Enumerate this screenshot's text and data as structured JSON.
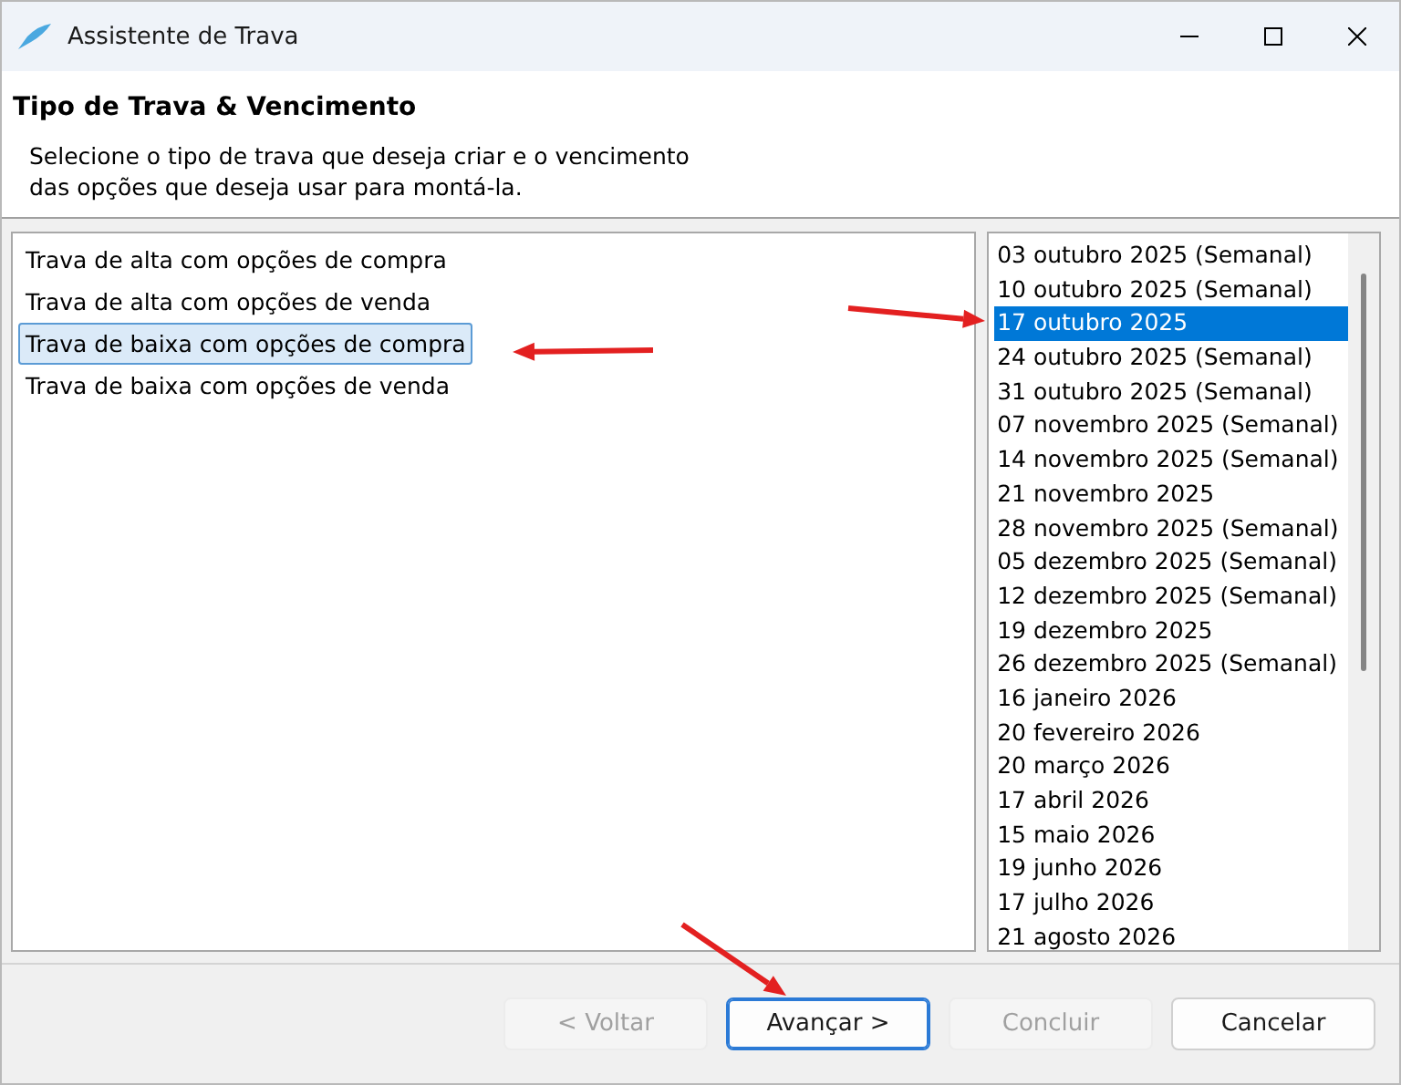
{
  "window": {
    "title": "Assistente de Trava"
  },
  "header": {
    "title": "Tipo de Trava & Vencimento",
    "description": "Selecione o tipo de trava que deseja criar e o vencimento das opções que deseja usar para montá-la."
  },
  "spread_types": [
    {
      "label": "Trava de alta com opções de compra",
      "selected": false
    },
    {
      "label": "Trava de alta com opções de venda",
      "selected": false
    },
    {
      "label": "Trava de baixa com opções de compra",
      "selected": true
    },
    {
      "label": "Trava de baixa com opções de venda",
      "selected": false
    }
  ],
  "expirations": [
    {
      "label": "03 outubro 2025 (Semanal)",
      "selected": false
    },
    {
      "label": "10 outubro 2025 (Semanal)",
      "selected": false
    },
    {
      "label": "17 outubro 2025",
      "selected": true
    },
    {
      "label": "24 outubro 2025 (Semanal)",
      "selected": false
    },
    {
      "label": "31 outubro 2025 (Semanal)",
      "selected": false
    },
    {
      "label": "07 novembro 2025 (Semanal)",
      "selected": false
    },
    {
      "label": "14 novembro 2025 (Semanal)",
      "selected": false
    },
    {
      "label": "21 novembro 2025",
      "selected": false
    },
    {
      "label": "28 novembro 2025 (Semanal)",
      "selected": false
    },
    {
      "label": "05 dezembro 2025 (Semanal)",
      "selected": false
    },
    {
      "label": "12 dezembro 2025 (Semanal)",
      "selected": false
    },
    {
      "label": "19 dezembro 2025",
      "selected": false
    },
    {
      "label": "26 dezembro 2025 (Semanal)",
      "selected": false
    },
    {
      "label": "16 janeiro 2026",
      "selected": false
    },
    {
      "label": "20 fevereiro 2026",
      "selected": false
    },
    {
      "label": "20 março 2026",
      "selected": false
    },
    {
      "label": "17 abril 2026",
      "selected": false
    },
    {
      "label": "15 maio 2026",
      "selected": false
    },
    {
      "label": "19 junho 2026",
      "selected": false
    },
    {
      "label": "17 julho 2026",
      "selected": false
    },
    {
      "label": "21 agosto 2026",
      "selected": false
    }
  ],
  "buttons": [
    {
      "label": "< Voltar",
      "disabled": true,
      "focused": false
    },
    {
      "label": "Avançar >",
      "disabled": false,
      "focused": true
    },
    {
      "label": "Concluir",
      "disabled": true,
      "focused": false
    },
    {
      "label": "Cancelar",
      "disabled": false,
      "focused": false
    }
  ]
}
